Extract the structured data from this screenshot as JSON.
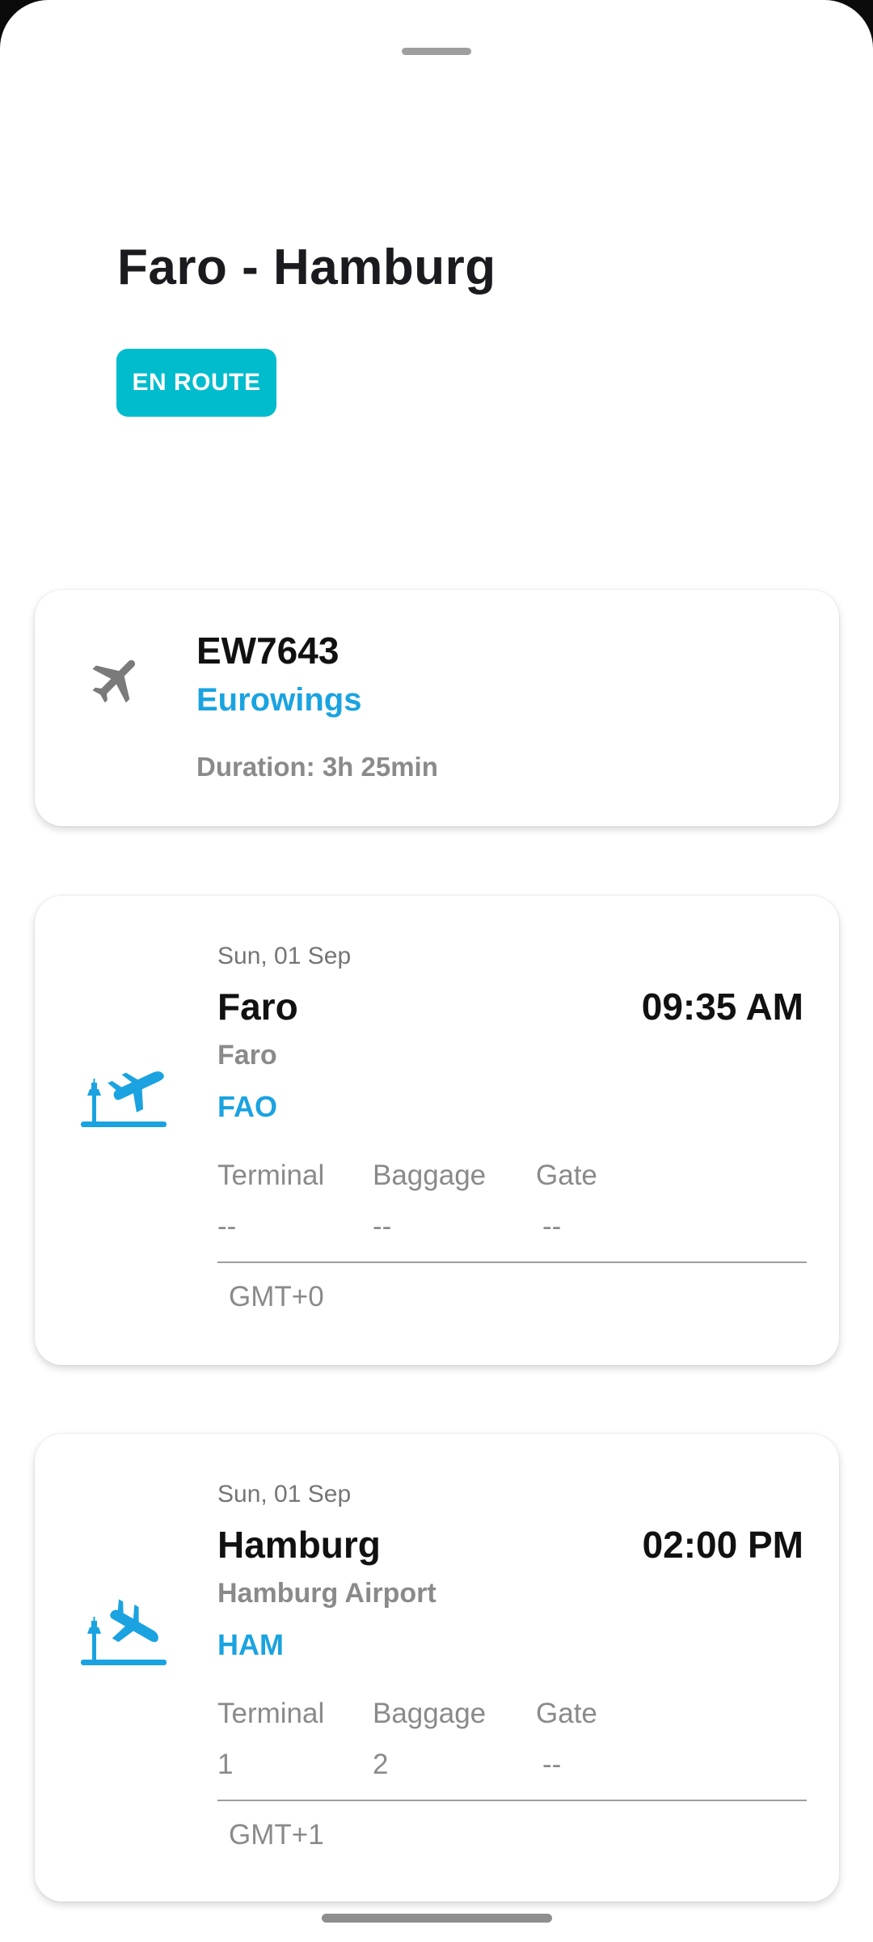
{
  "route": {
    "title": "Faro - Hamburg",
    "status": "EN ROUTE"
  },
  "flight": {
    "number": "EW7643",
    "airline": "Eurowings",
    "duration": "Duration: 3h 25min",
    "icon": "airplane-icon"
  },
  "departure": {
    "icon": "takeoff-icon",
    "date": "Sun, 01 Sep",
    "city": "Faro",
    "time": "09:35 AM",
    "airport": "Faro",
    "code": "FAO",
    "terminal_label": "Terminal",
    "baggage_label": "Baggage",
    "gate_label": "Gate",
    "terminal": "--",
    "baggage": "--",
    "gate": "--",
    "timezone": "GMT+0"
  },
  "arrival": {
    "icon": "landing-icon",
    "date": "Sun, 01 Sep",
    "city": "Hamburg",
    "time": "02:00 PM",
    "airport": "Hamburg Airport",
    "code": "HAM",
    "terminal_label": "Terminal",
    "baggage_label": "Baggage",
    "gate_label": "Gate",
    "terminal": "1",
    "baggage": "2",
    "gate": "--",
    "timezone": "GMT+1"
  },
  "colors": {
    "accent": "#1aa3e0",
    "badge": "#00bccc",
    "muted": "#8a8a8a"
  }
}
